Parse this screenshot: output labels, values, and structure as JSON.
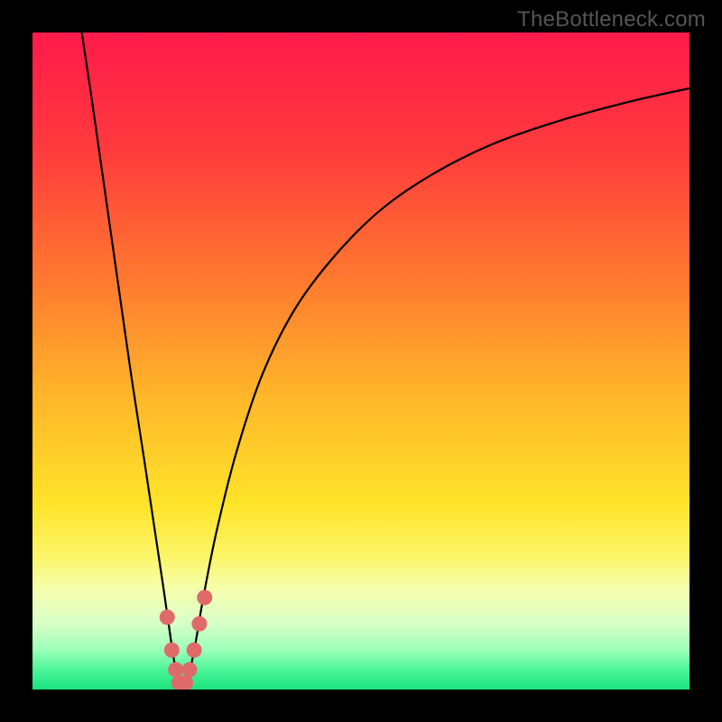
{
  "watermark": "TheBottleneck.com",
  "chart_data": {
    "type": "line",
    "title": "",
    "xlabel": "",
    "ylabel": "",
    "xlim": [
      0,
      100
    ],
    "ylim": [
      0,
      100
    ],
    "legend": false,
    "grid": false,
    "background_gradient": {
      "stops": [
        {
          "pos": 0.0,
          "color": "#ff1a4b"
        },
        {
          "pos": 0.18,
          "color": "#ff3b3d"
        },
        {
          "pos": 0.38,
          "color": "#ff7a2f"
        },
        {
          "pos": 0.55,
          "color": "#ffb52a"
        },
        {
          "pos": 0.72,
          "color": "#ffe42a"
        },
        {
          "pos": 0.8,
          "color": "#fbf66b"
        },
        {
          "pos": 0.85,
          "color": "#f5ffb0"
        },
        {
          "pos": 0.9,
          "color": "#d8ffc8"
        },
        {
          "pos": 0.94,
          "color": "#9cffb8"
        },
        {
          "pos": 0.97,
          "color": "#4cf59a"
        },
        {
          "pos": 1.0,
          "color": "#19e37e"
        }
      ]
    },
    "series": [
      {
        "name": "bottleneck-curve",
        "color": "#000000",
        "x": [
          7.5,
          9,
          11,
          13,
          15,
          17,
          18.5,
          20,
          21,
          21.8,
          22.5,
          23,
          23.5,
          24,
          24.8,
          26,
          28,
          31,
          35,
          40,
          46,
          53,
          61,
          70,
          80,
          91,
          100
        ],
        "y": [
          100,
          90,
          76,
          62,
          48,
          35,
          25,
          15,
          8,
          3,
          1,
          0.5,
          1,
          3,
          7,
          14,
          24,
          36,
          48,
          58,
          66,
          73,
          78.5,
          83,
          86.5,
          89.5,
          91.5
        ]
      },
      {
        "name": "marker-cluster",
        "type": "scatter",
        "color": "#e06a6a",
        "x": [
          20.5,
          21.2,
          21.8,
          22.3,
          22.8,
          23.3,
          23.9,
          24.6,
          25.4,
          26.2
        ],
        "y": [
          11,
          6,
          3,
          1,
          0.5,
          1,
          3,
          6,
          10,
          14
        ]
      }
    ]
  }
}
